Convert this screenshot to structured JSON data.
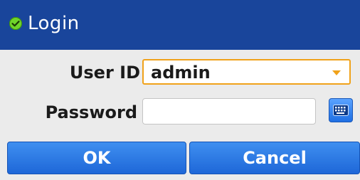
{
  "dialog": {
    "title": "Login",
    "icon": "checkmark-circle-icon"
  },
  "form": {
    "user_id_label": "User ID",
    "user_id_value": "admin",
    "password_label": "Password",
    "password_value": "",
    "keyboard_icon": "virtual-keyboard-icon"
  },
  "actions": {
    "ok_label": "OK",
    "cancel_label": "Cancel"
  },
  "colors": {
    "titlebar": "#19459b",
    "accent_focus": "#f0a21a",
    "button": "#2a78e4",
    "status_icon": "#6fd42a"
  }
}
